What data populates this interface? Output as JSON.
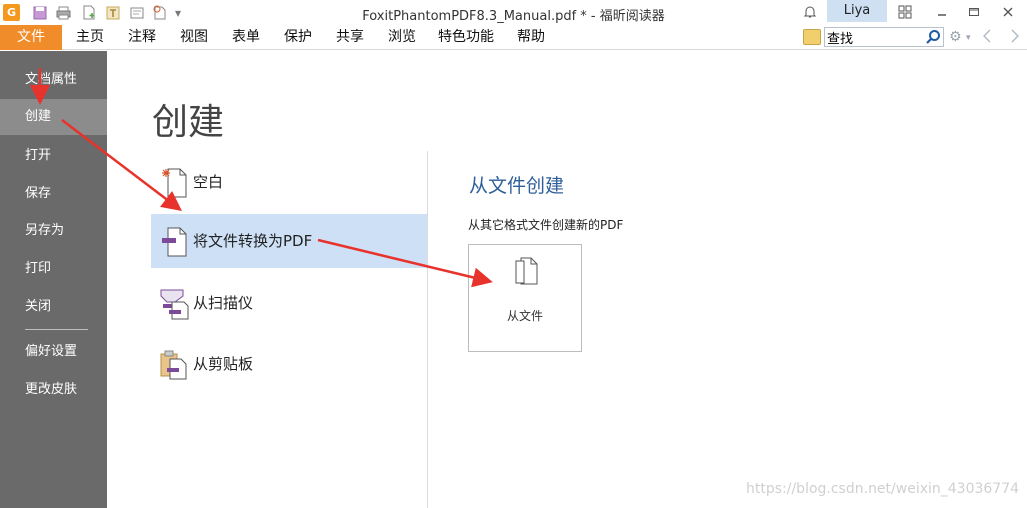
{
  "titlebar": {
    "title": "FoxitPhantomPDF8.3_Manual.pdf * - 福昕阅读器",
    "user": "Liya",
    "logo_glyph": "G"
  },
  "menubar": {
    "file_tab": "文件",
    "items": [
      "主页",
      "注释",
      "视图",
      "表单",
      "保护",
      "共享",
      "浏览",
      "特色功能",
      "帮助"
    ],
    "search": {
      "value": "查找",
      "placeholder": ""
    }
  },
  "sidebar": {
    "items": [
      "文档属性",
      "创建",
      "打开",
      "保存",
      "另存为",
      "打印",
      "关闭",
      "偏好设置",
      "更改皮肤"
    ],
    "active_index": 1
  },
  "main": {
    "title": "创建",
    "options": [
      {
        "label": "空白",
        "icon": "blank-page-icon"
      },
      {
        "label": "将文件转换为PDF",
        "icon": "convert-file-icon"
      },
      {
        "label": "从扫描仪",
        "icon": "scanner-icon"
      },
      {
        "label": "从剪贴板",
        "icon": "clipboard-icon"
      }
    ],
    "selected_index": 1,
    "panel": {
      "title": "从文件创建",
      "description": "从其它格式文件创建新的PDF",
      "button_label": "从文件"
    }
  },
  "watermark": "https://blog.csdn.net/weixin_43036774",
  "colors": {
    "accent_orange": "#f08c2a",
    "sidebar_bg": "#6a6a6a",
    "selected_bg": "#cde0f6",
    "panel_title": "#2f5f9b",
    "annotation_red": "#e8322c",
    "icon_purple": "#7b4b9a"
  }
}
